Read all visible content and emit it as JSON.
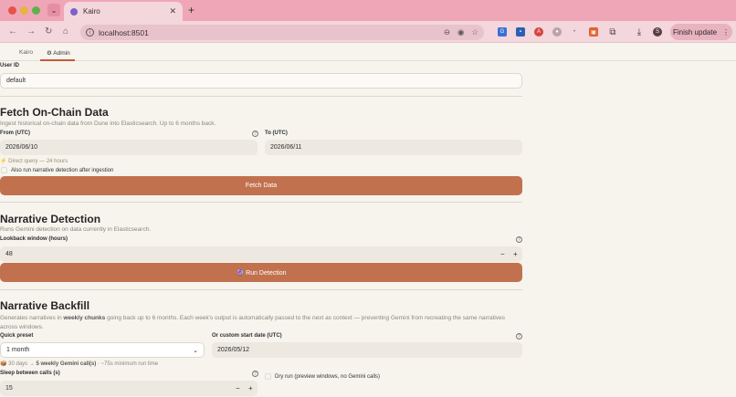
{
  "browser": {
    "tab_title": "Kairo",
    "url": "localhost:8501",
    "finish_update_label": "Finish update",
    "profile_initial": "S",
    "tab_close": "✕",
    "new_tab": "+",
    "colors": {
      "tabbar": "#efa6b7",
      "toolbar": "#f4d6dd"
    }
  },
  "app_tabs": [
    {
      "label": "Kairo"
    },
    {
      "label": "⚙ Admin"
    }
  ],
  "user": {
    "label": "User ID",
    "value": "default"
  },
  "fetch": {
    "title": "Fetch On-Chain Data",
    "description": "Ingest historical on-chain data from Dune into Elasticsearch. Up to 6 months back.",
    "from_label": "From (UTC)",
    "from_value": "2026/06/10",
    "to_label": "To (UTC)",
    "to_value": "2026/06/11",
    "note": "⚡ Direct query — 24 hours",
    "checkbox_label": "Also run narrative detection after ingestion",
    "button_label": "Fetch Data"
  },
  "detection": {
    "title": "Narrative Detection",
    "description": "Runs Gemini detection on data currently in Elasticsearch.",
    "lookback_label": "Lookback window (hours)",
    "lookback_value": "48",
    "button_label": "🔮 Run Detection"
  },
  "backfill": {
    "title": "Narrative Backfill",
    "description_pre": "Generates narratives in ",
    "description_bold": "weekly chunks",
    "description_post": " going back up to 6 months. Each week's output is automatically passed to the next as context — preventing Gemini from recreating the same narratives across windows.",
    "preset_label": "Quick preset",
    "preset_value": "1 month",
    "custom_label": "Or custom start date (UTC)",
    "custom_value": "2026/05/12",
    "summary_pre": "📦 30 days → ",
    "summary_bold": "5 weekly Gemini call(s)",
    "summary_post": " · ~75s minimum run time",
    "sleep_label": "Sleep between calls (s)",
    "sleep_value": "15",
    "dryrun_label": "Dry run (preview windows, no Gemini calls)"
  },
  "icons": {
    "help": "help-circle-icon",
    "minus": "−",
    "plus": "+",
    "chevron": "⌄"
  }
}
